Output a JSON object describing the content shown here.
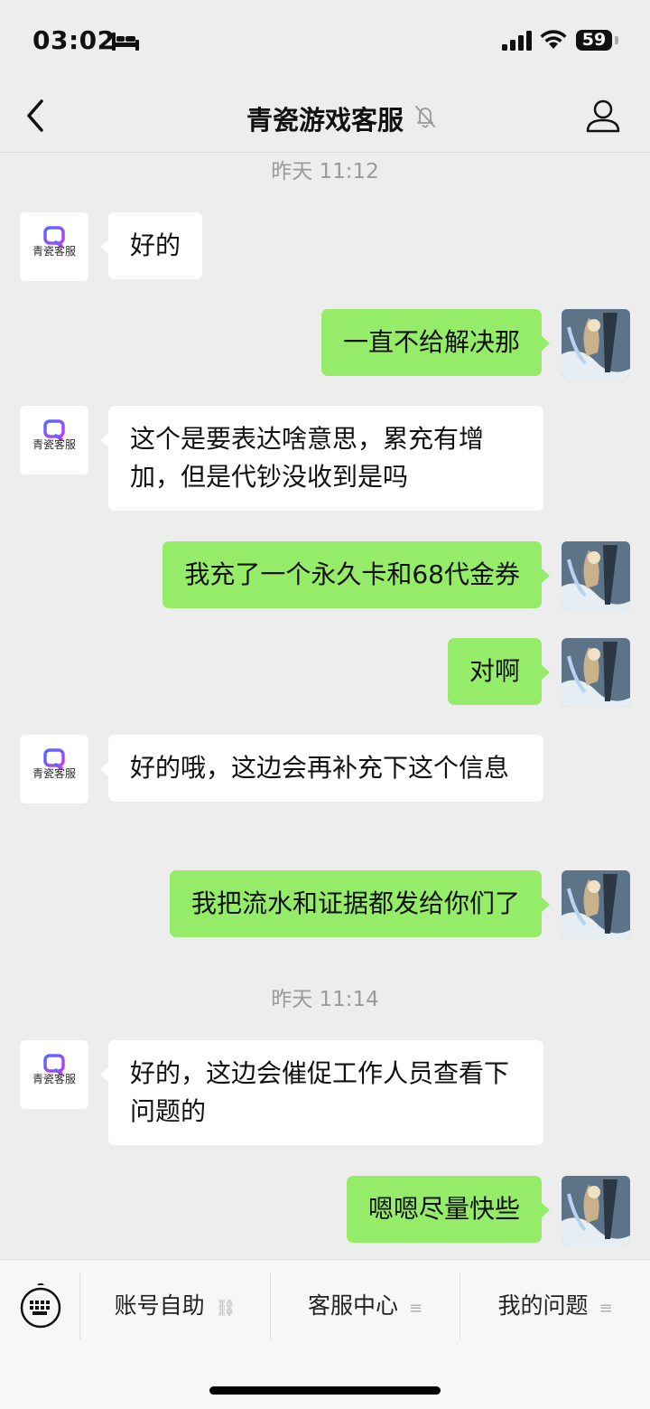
{
  "status_bar": {
    "time": "03:02",
    "battery": "59"
  },
  "header": {
    "title": "青瓷游戏客服"
  },
  "service": {
    "logo_letter": "Q",
    "logo_text": "青瓷客服"
  },
  "timestamps": [
    "昨天 11:12",
    "昨天 11:14"
  ],
  "messages": [
    {
      "side": "left",
      "text": "好的"
    },
    {
      "side": "right",
      "text": "一直不给解决那"
    },
    {
      "side": "left",
      "text": "这个是要表达啥意思，累充有增加，但是代钞没收到是吗"
    },
    {
      "side": "right",
      "text": "我充了一个永久卡和68代金券"
    },
    {
      "side": "right",
      "text": "对啊"
    },
    {
      "side": "left",
      "text": "好的哦，这边会再补充下这个信息"
    },
    {
      "side": "right",
      "text": "我把流水和证据都发给你们了"
    },
    {
      "side": "left",
      "text": "好的，这边会催促工作人员查看下问题的"
    },
    {
      "side": "right",
      "text": "嗯嗯尽量快些"
    }
  ],
  "bottom_menu": [
    {
      "label": "账号自助",
      "icon": "link-icon"
    },
    {
      "label": "客服中心",
      "icon": "menu-icon"
    },
    {
      "label": "我的问题",
      "icon": "menu-icon"
    }
  ],
  "colors": {
    "self_bubble": "#95ec69",
    "other_bubble": "#ffffff",
    "background": "#ededed"
  }
}
